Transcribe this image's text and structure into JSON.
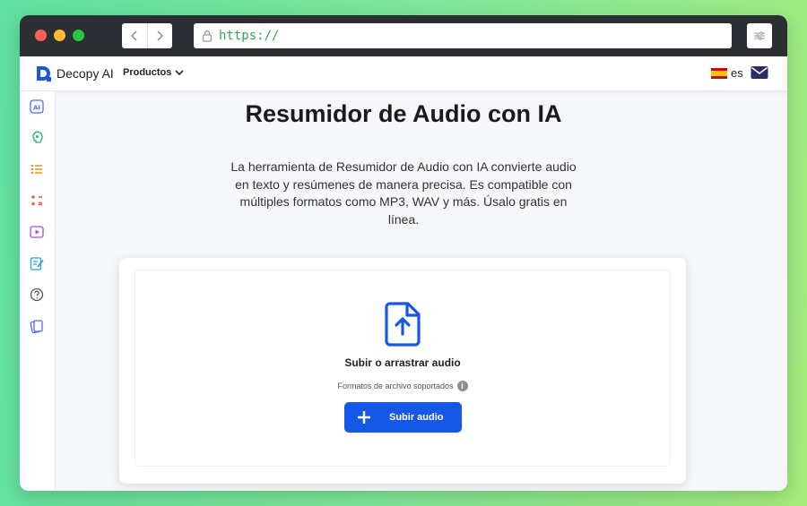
{
  "browser": {
    "url": "https://",
    "back_icon": "chevron-left-icon",
    "forward_icon": "chevron-right-icon",
    "settings_icon": "sliders-icon"
  },
  "header": {
    "brand": "Decopy AI",
    "products_label": "Productos",
    "language": "es",
    "mail_icon": "mail-icon"
  },
  "sidebar": {
    "items": [
      {
        "icon": "ai-icon",
        "color": "#4a6cf7"
      },
      {
        "icon": "speech-icon",
        "color": "#22b573"
      },
      {
        "icon": "list-icon",
        "color": "#f08a24"
      },
      {
        "icon": "calculator-icon",
        "color": "#e2574c"
      },
      {
        "icon": "video-icon",
        "color": "#9b51e0"
      },
      {
        "icon": "edit-icon",
        "color": "#2f9be0"
      },
      {
        "icon": "help-icon",
        "color": "#555555"
      },
      {
        "icon": "cards-icon",
        "color": "#4a6cf7"
      }
    ]
  },
  "main": {
    "title": "Resumidor de Audio con IA",
    "description": "La herramienta de Resumidor de Audio con IA convierte audio en texto y resúmenes de manera precisa. Es compatible con múltiples formatos como MP3, WAV y más. Úsalo gratis en línea.",
    "upload": {
      "title": "Subir o arrastrar audio",
      "formats_label": "Formatos de archivo soportados",
      "button_label": "Subir audio",
      "accent_color": "#1557e6"
    }
  }
}
